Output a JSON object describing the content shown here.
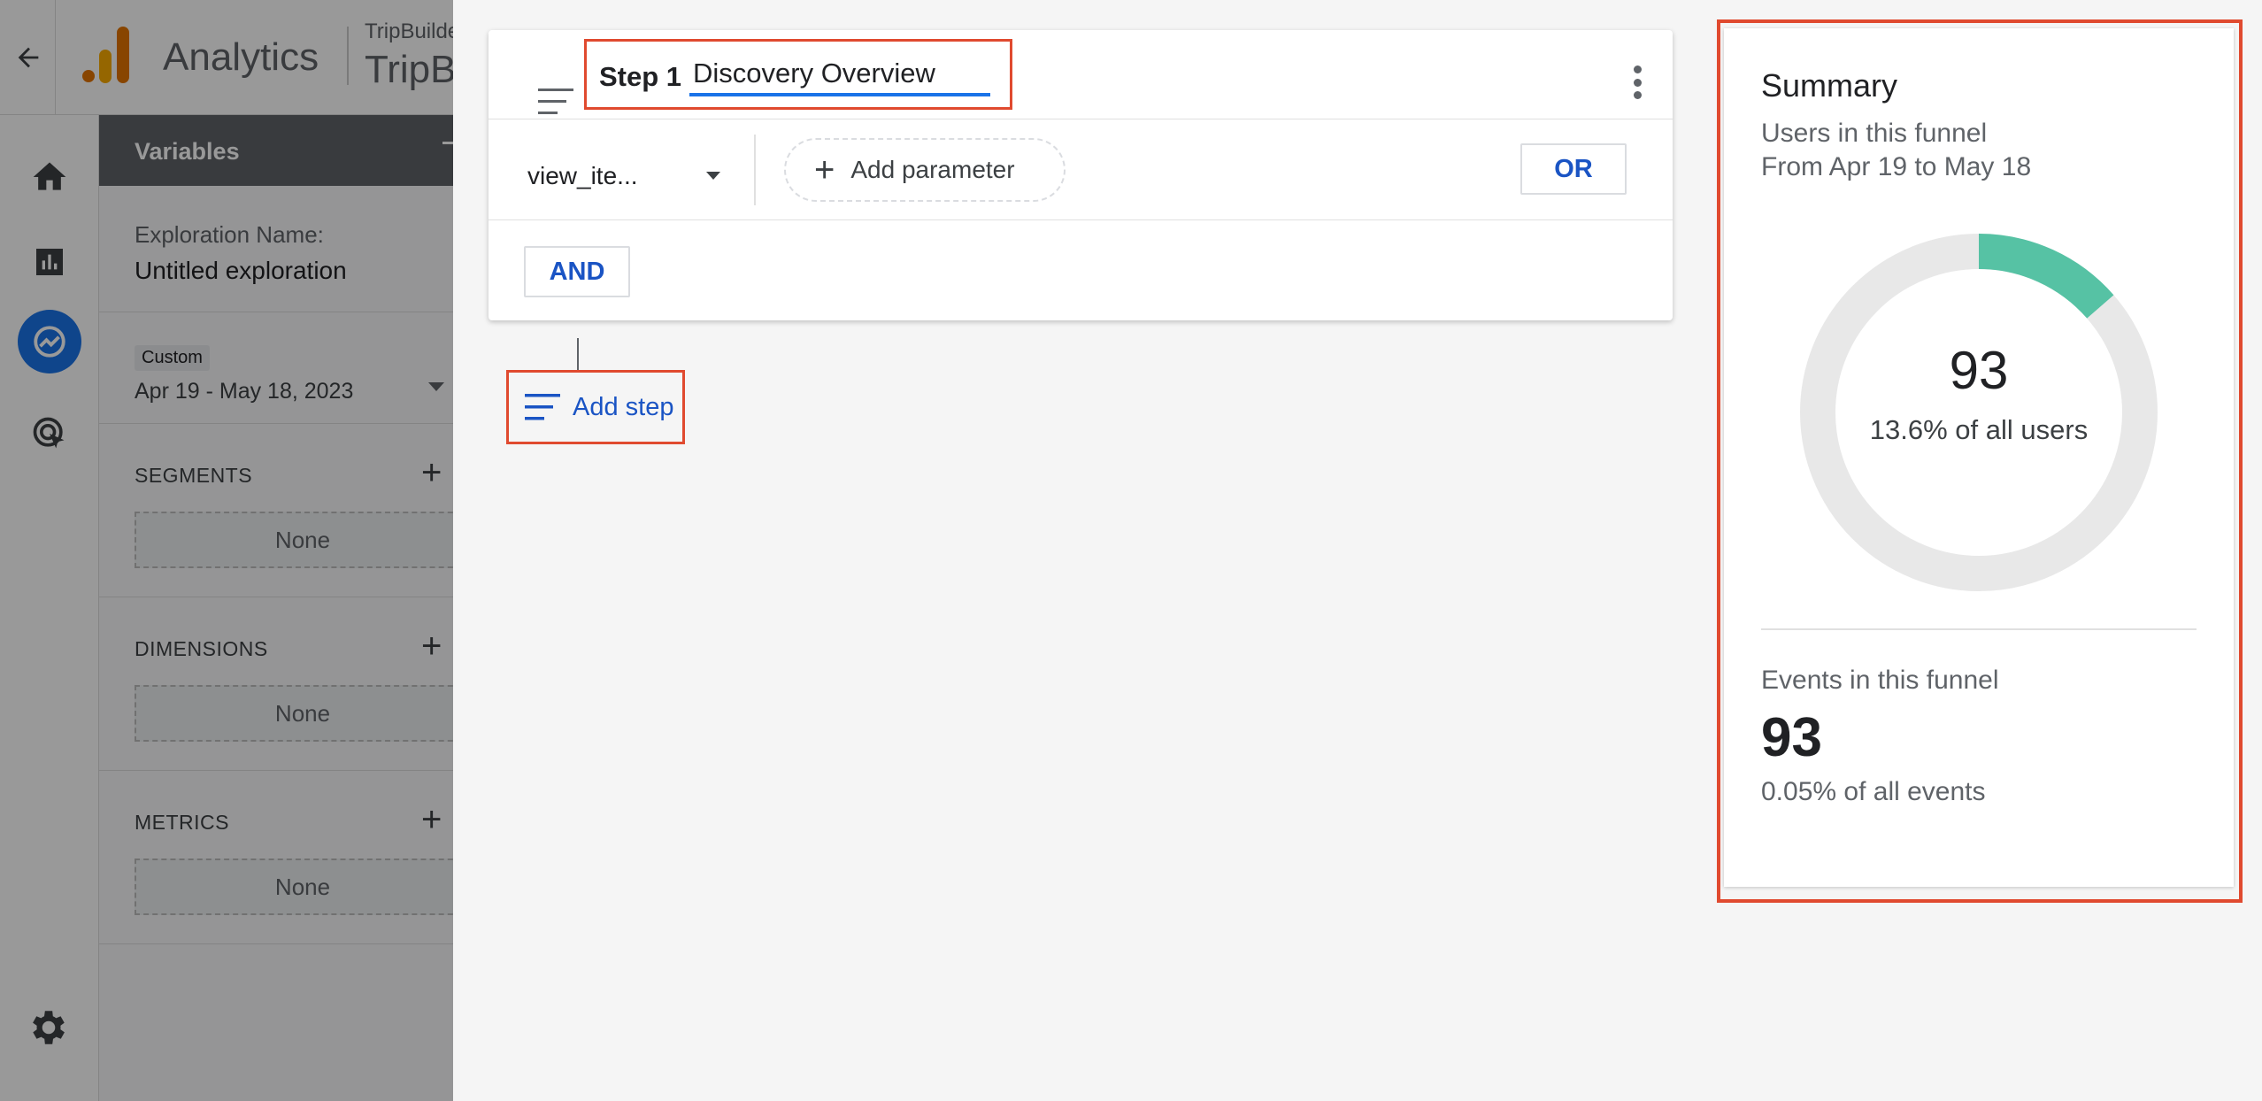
{
  "app": {
    "name": "Analytics",
    "account_small": "TripBuilder",
    "account_big": "TripB"
  },
  "variables": {
    "title": "Variables",
    "exploration_label": "Exploration Name:",
    "exploration_value": "Untitled exploration",
    "date_chip": "Custom",
    "date_range": "Apr 19 - May 18, 2023",
    "segments_label": "SEGMENTS",
    "segments_value": "None",
    "dimensions_label": "DIMENSIONS",
    "dimensions_value": "None",
    "metrics_label": "METRICS",
    "metrics_value": "None"
  },
  "step": {
    "label": "Step 1",
    "name_value": "Discovery Overview",
    "event_name": "view_ite...",
    "add_parameter": "Add parameter",
    "or_label": "OR",
    "and_label": "AND"
  },
  "add_step_label": "Add step",
  "summary": {
    "title": "Summary",
    "users_label": "Users in this funnel",
    "date_range": "From Apr 19 to May 18",
    "users_count": "93",
    "users_pct": "13.6% of all users",
    "users_fraction": 0.136,
    "events_label": "Events in this funnel",
    "events_count": "93",
    "events_pct": "0.05% of all events"
  },
  "colors": {
    "accent_blue": "#1a73e8",
    "link_blue": "#1a54c4",
    "donut_fill": "#56c2a4",
    "donut_track": "#e8e8e8",
    "highlight_red": "#e04a2f"
  },
  "icons": {
    "back": "arrow-left-icon",
    "home": "home-icon",
    "reports": "bar-chart-icon",
    "explore": "explore-icon",
    "advertising": "cursor-target-icon",
    "settings": "gear-icon",
    "drag": "drag-handle-icon",
    "more": "more-vert-icon"
  }
}
